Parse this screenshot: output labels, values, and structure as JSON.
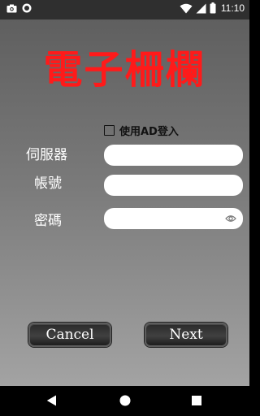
{
  "status_bar": {
    "time": "11:10",
    "icons": [
      "camera-icon",
      "record-icon",
      "wifi-icon",
      "signal-icon",
      "battery-icon"
    ]
  },
  "app": {
    "title": "電子柵欄",
    "title_color": "#ff1a1a"
  },
  "login": {
    "ad_checkbox_label": "使用AD登入",
    "ad_checked": false,
    "server_label": "伺服器",
    "server_value": "",
    "account_label": "帳號",
    "account_value": "",
    "password_label": "密碼",
    "password_value": ""
  },
  "buttons": {
    "cancel": "Cancel",
    "next": "Next"
  },
  "nav": {
    "icons": [
      "back-icon",
      "home-icon",
      "recents-icon"
    ]
  }
}
